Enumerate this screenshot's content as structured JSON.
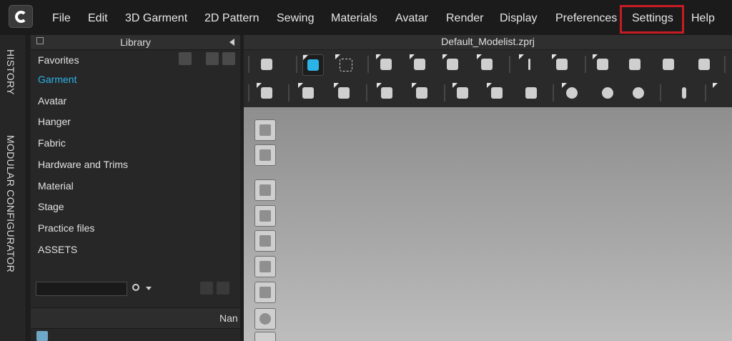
{
  "menu": {
    "items": [
      {
        "id": "file",
        "label": "File"
      },
      {
        "id": "edit",
        "label": "Edit"
      },
      {
        "id": "3d-garment",
        "label": "3D Garment"
      },
      {
        "id": "2d-pattern",
        "label": "2D Pattern"
      },
      {
        "id": "sewing",
        "label": "Sewing"
      },
      {
        "id": "materials",
        "label": "Materials"
      },
      {
        "id": "avatar",
        "label": "Avatar"
      },
      {
        "id": "render",
        "label": "Render"
      },
      {
        "id": "display",
        "label": "Display"
      },
      {
        "id": "preferences",
        "label": "Preferences"
      },
      {
        "id": "settings",
        "label": "Settings"
      },
      {
        "id": "help",
        "label": "Help"
      }
    ],
    "highlight_color": "#c81c24"
  },
  "side_tabs": {
    "history": "HISTORY",
    "modular_configurator": "MODULAR CONFIGURATOR"
  },
  "library": {
    "title": "Library",
    "favorites_label": "Favorites",
    "items": [
      {
        "label": "Garment",
        "selected": true
      },
      {
        "label": "Avatar",
        "selected": false
      },
      {
        "label": "Hanger",
        "selected": false
      },
      {
        "label": "Fabric",
        "selected": false
      },
      {
        "label": "Hardware and Trims",
        "selected": false
      },
      {
        "label": "Material",
        "selected": false
      },
      {
        "label": "Stage",
        "selected": false
      },
      {
        "label": "Practice files",
        "selected": false
      },
      {
        "label": "ASSETS",
        "selected": false
      }
    ],
    "selected_color": "#2bb3e8",
    "column_name_label": "Nan"
  },
  "main": {
    "file_title": "Default_Modelist.zprj"
  },
  "icons": {
    "logo": "logo-c-icon",
    "search": "magnifier-icon",
    "refresh": "refresh-icon",
    "grid_view": "grid-view-icon",
    "download": "download-icon",
    "add": "plus-icon",
    "back": "back-arrow-icon",
    "popout": "popout-icon",
    "collapse": "collapse-arrow-icon"
  }
}
